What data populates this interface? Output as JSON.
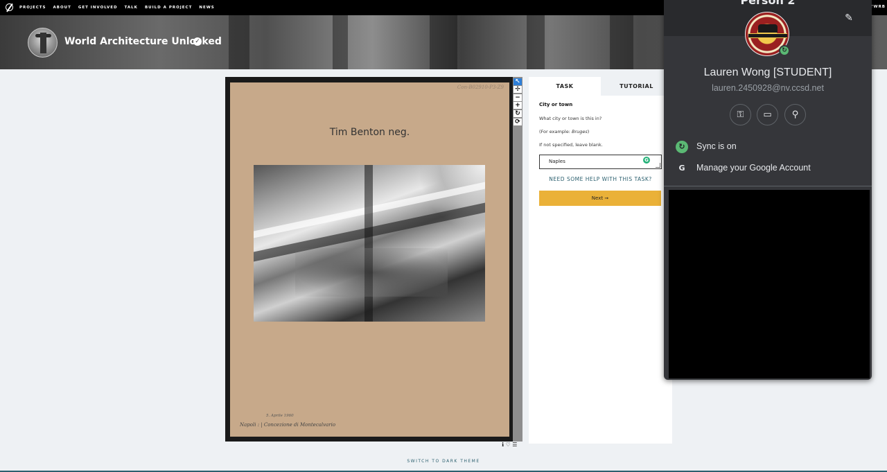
{
  "nav": {
    "items": [
      "PROJECTS",
      "ABOUT",
      "GET INVOLVED",
      "TALK",
      "BUILD A PROJECT",
      "NEWS"
    ],
    "right_text": "TWRB"
  },
  "project": {
    "title": "World Architecture Unlocked",
    "verified_icon": "check-circle-icon"
  },
  "subject": {
    "catalog_no": "Con-B02910-P3-Z9",
    "caption": "Tim Benton neg.",
    "handwriting_line1": "5. Aprile 1960",
    "handwriting_line2": "Napoli : | Concezione  di  Montecalvario"
  },
  "viewer_tools": [
    "pointer-icon",
    "pan-icon",
    "zoom-out-icon",
    "zoom-in-icon",
    "rotate-icon",
    "reset-icon"
  ],
  "viewer_tool_glyphs": [
    "↖",
    "✢",
    "−",
    "+",
    "↻",
    "⟳"
  ],
  "viewer_footer_glyphs": "ℹ ♡ ☰",
  "task": {
    "tabs": [
      "TASK",
      "TUTORIAL"
    ],
    "question_title": "City or town",
    "line1": "What city or town is this in?",
    "line2_prefix": "(For example: ",
    "line2_example": "Bruges",
    "line2_suffix": ")",
    "line3": "If not specified, leave blank.",
    "answer_value": "Naples",
    "help_link": "NEED SOME HELP WITH THIS TASK?",
    "next_button": "Next ➞"
  },
  "footer": {
    "theme_toggle": "SWITCH TO DARK THEME"
  },
  "google_popup": {
    "header": "Person 2",
    "name": "Lauren Wong [STUDENT]",
    "email": "lauren.2450928@nv.ccsd.net",
    "badge_text": "WEST CAREER & TECH ACADEMY - HOME OF THE WRANGLERS",
    "quick_actions": [
      "key-icon",
      "credit-card-icon",
      "location-pin-icon"
    ],
    "sync_label": "Sync is on",
    "manage_label": "Manage your Google Account",
    "colors": {
      "sync": "#5bb974",
      "bg": "#35363a",
      "text": "#e8eaed"
    }
  }
}
